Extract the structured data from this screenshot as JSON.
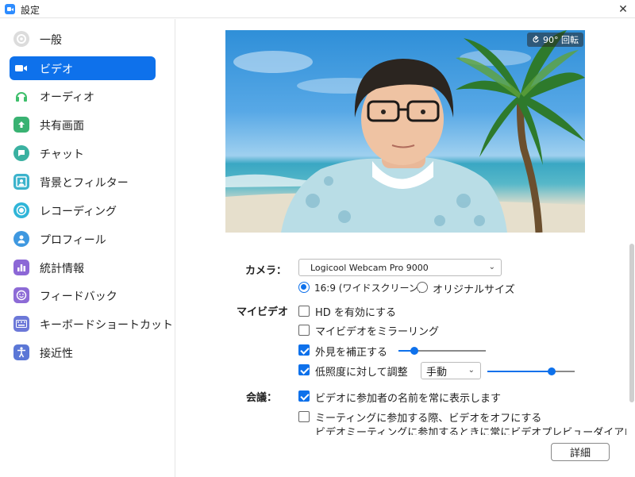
{
  "window": {
    "title": "設定",
    "close": "✕"
  },
  "sidebar": {
    "items": [
      {
        "label": "一般",
        "color": "#d8d8d8"
      },
      {
        "label": "ビデオ",
        "color": "#0e71eb",
        "active": true
      },
      {
        "label": "オーディオ",
        "color": "#3ebf6b"
      },
      {
        "label": "共有画面",
        "color": "#39b272"
      },
      {
        "label": "チャット",
        "color": "#3ab1a1"
      },
      {
        "label": "背景とフィルター",
        "color": "#3cb3cc"
      },
      {
        "label": "レコーディング",
        "color": "#2fb5d8"
      },
      {
        "label": "プロフィール",
        "color": "#3e98e0"
      },
      {
        "label": "統計情報",
        "color": "#8c67d6"
      },
      {
        "label": "フィードバック",
        "color": "#8d6bd6"
      },
      {
        "label": "キーボードショートカット",
        "color": "#6c78d8"
      },
      {
        "label": "接近性",
        "color": "#5b77d6"
      }
    ]
  },
  "preview": {
    "rotate_label": "90° 回転"
  },
  "camera": {
    "label": "カメラ：",
    "selected": "Logicool Webcam Pro 9000",
    "ratio_169": "16:9 (ワイドスクリーン)",
    "ratio_original": "オリジナルサイズ"
  },
  "my_video": {
    "label": "マイビデオ",
    "hd": "HD を有効にする",
    "mirror": "マイビデオをミラーリング",
    "touch_up": "外見を補正する",
    "touch_up_level": 0.18,
    "low_light": "低照度に対して調整",
    "low_light_mode": "手動",
    "low_light_level": 0.74
  },
  "meeting": {
    "label": "会議：",
    "show_names": "ビデオに参加者の名前を常に表示します",
    "video_off": "ミーティングに参加する際、ビデオをオフにする",
    "preview_dialog": "ビデオミーティングに参加するときに常にビデオプレビューダイアログを表"
  },
  "buttons": {
    "detail": "詳細"
  }
}
